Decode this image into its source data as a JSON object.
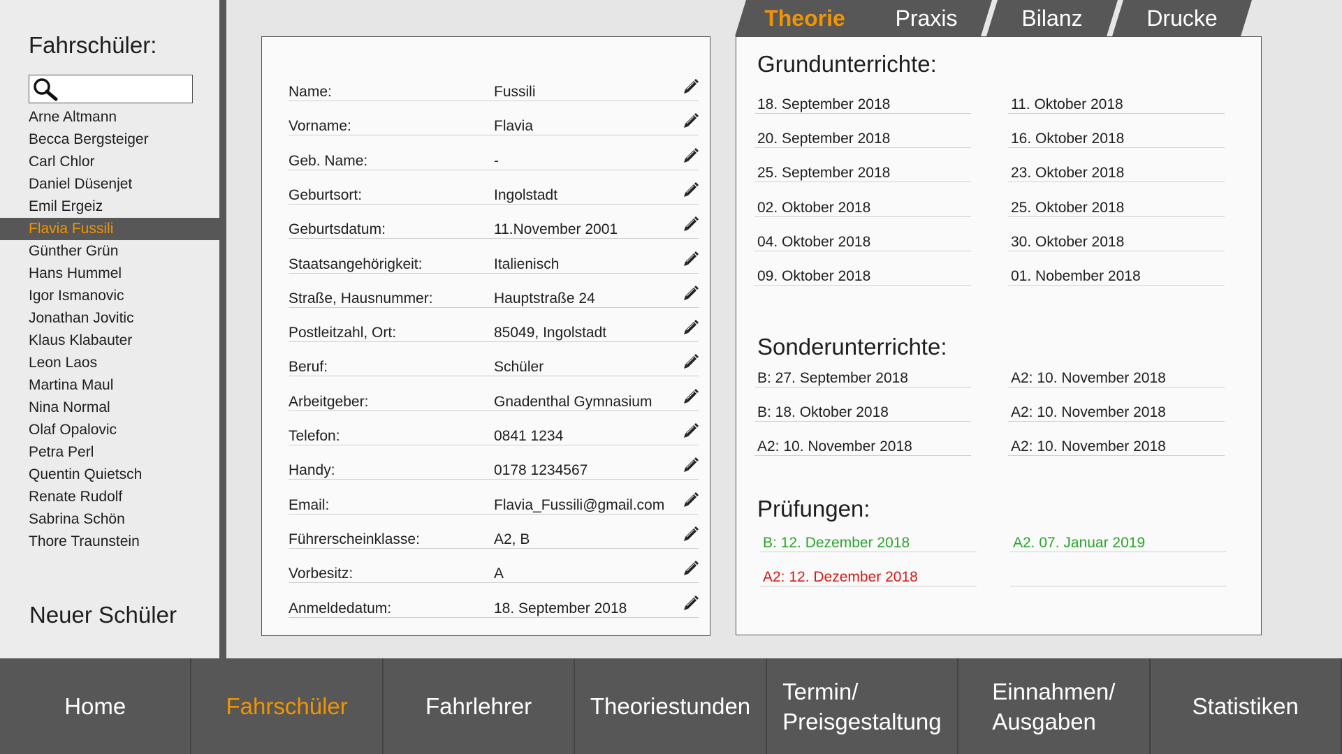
{
  "sidebar": {
    "title": "Fahrschüler:",
    "search_placeholder": "",
    "students": [
      "Arne Altmann",
      "Becca Bergsteiger",
      "Carl Chlor",
      "Daniel Düsenjet",
      "Emil Ergeiz",
      "Flavia Fussili",
      "Günther Grün",
      "Hans Hummel",
      "Igor Ismanovic",
      "Jonathan Jovitic",
      "Klaus Klabauter",
      "Leon Laos",
      "Martina Maul",
      "Nina Normal",
      "Olaf Opalovic",
      "Petra Perl",
      "Quentin Quietsch",
      "Renate Rudolf",
      "Sabrina Schön",
      "Thore Traunstein"
    ],
    "selected_student": "Flavia Fussili",
    "new_student_label": "Neuer Schüler"
  },
  "details": {
    "fields": [
      {
        "label": "Name:",
        "value": "Fussili"
      },
      {
        "label": "Vorname:",
        "value": "Flavia"
      },
      {
        "label": "Geb. Name:",
        "value": "-"
      },
      {
        "label": "Geburtsort:",
        "value": "Ingolstadt"
      },
      {
        "label": "Geburtsdatum:",
        "value": "11.November 2001"
      },
      {
        "label": "Staatsangehörigkeit:",
        "value": "Italienisch"
      },
      {
        "label": "Straße, Hausnummer:",
        "value": "Hauptstraße 24"
      },
      {
        "label": "Postleitzahl, Ort:",
        "value": "85049, Ingolstadt"
      },
      {
        "label": "Beruf:",
        "value": "Schüler"
      },
      {
        "label": "Arbeitgeber:",
        "value": "Gnadenthal Gymnasium"
      },
      {
        "label": "Telefon:",
        "value": "0841 1234"
      },
      {
        "label": "Handy:",
        "value": "0178 1234567"
      },
      {
        "label": "Email:",
        "value": "Flavia_Fussili@gmail.com"
      },
      {
        "label": "Führerscheinklasse:",
        "value": "A2, B"
      },
      {
        "label": "Vorbesitz:",
        "value": "A"
      },
      {
        "label": "Anmeldedatum:",
        "value": "18. September 2018"
      }
    ]
  },
  "tabs": [
    {
      "label": "Theorie",
      "active": true
    },
    {
      "label": "Praxis",
      "active": false
    },
    {
      "label": "Bilanz",
      "active": false
    },
    {
      "label": "Drucke",
      "active": false
    }
  ],
  "theory": {
    "grund_title": "Grundunterrichte:",
    "grund_left": [
      "18. September 2018",
      "20. September 2018",
      "25. September 2018",
      "02. Oktober 2018",
      "04. Oktober 2018",
      "09. Oktober 2018"
    ],
    "grund_right": [
      "11. Oktober 2018",
      "16. Oktober 2018",
      "23. Oktober 2018",
      "25. Oktober 2018",
      "30. Oktober 2018",
      "01. Nobember 2018"
    ],
    "sonder_title": "Sonderunterrichte:",
    "sonder_left": [
      "B: 27. September 2018",
      "B: 18. Oktober 2018",
      "A2: 10. November 2018"
    ],
    "sonder_right": [
      "A2: 10. November 2018",
      "A2: 10. November 2018",
      "A2: 10. November 2018"
    ],
    "pruef_title": "Prüfungen:",
    "pruef_left": [
      {
        "text": "B: 12. Dezember 2018",
        "status": "passed"
      },
      {
        "text": "A2: 12. Dezember 2018",
        "status": "failed"
      }
    ],
    "pruef_right": [
      {
        "text": "A2. 07. Januar 2019",
        "status": "passed"
      },
      {
        "text": "",
        "status": "empty"
      }
    ]
  },
  "nav": {
    "items": [
      {
        "label_1": "Home",
        "label_2": "",
        "active": false
      },
      {
        "label_1": "Fahrschüler",
        "label_2": "",
        "active": true
      },
      {
        "label_1": "Fahrlehrer",
        "label_2": "",
        "active": false
      },
      {
        "label_1": "Theoriestunden",
        "label_2": "",
        "active": false
      },
      {
        "label_1": "Termin/",
        "label_2": "Preisgestaltung",
        "active": false
      },
      {
        "label_1": "Einnahmen/",
        "label_2": "Ausgaben",
        "active": false
      },
      {
        "label_1": "Statistiken",
        "label_2": "",
        "active": false
      }
    ]
  },
  "colors": {
    "accent": "#f29400",
    "dark": "#575757",
    "passed": "#2aa52a",
    "failed": "#d21a1a"
  },
  "icons": {
    "search": "magnifier-icon",
    "edit": "pencil-icon"
  }
}
